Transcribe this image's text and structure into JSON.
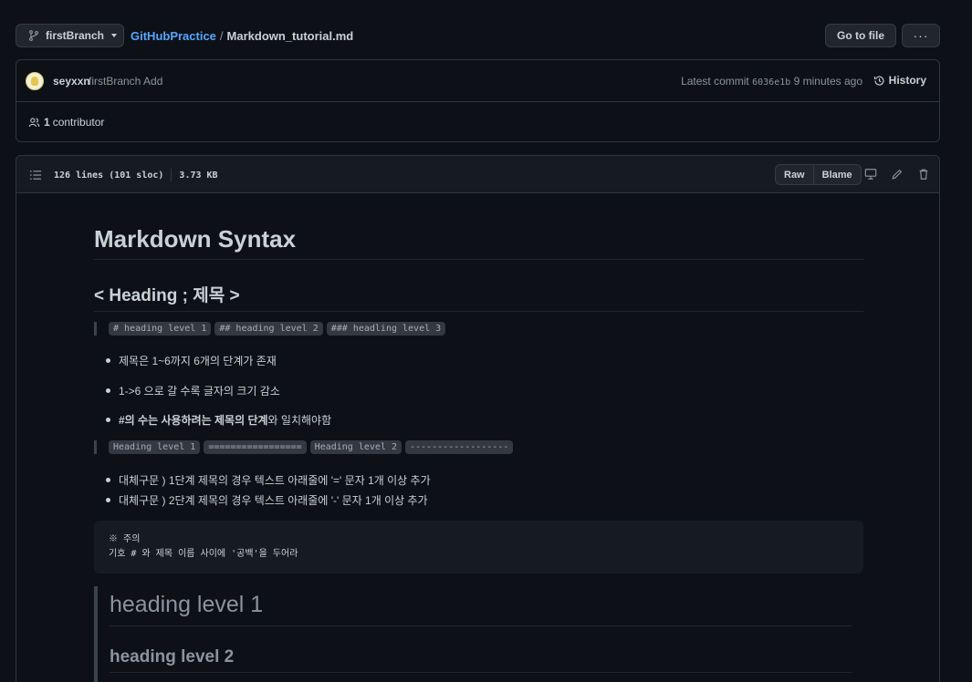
{
  "topbar": {
    "branch_label": "firstBranch",
    "repo_name": "GitHubPractice",
    "path_separator": "/",
    "file_name": "Markdown_tutorial.md",
    "goto_label": "Go to file",
    "more_label": "···"
  },
  "commit": {
    "author": "seyxxn",
    "message": "firstBranch Add",
    "latest_prefix": "Latest commit",
    "sha": "6036e1b",
    "time": "9 minutes ago",
    "history_label": "History"
  },
  "contributors": {
    "count": "1",
    "label": "contributor"
  },
  "file": {
    "lines": "126 lines (101 sloc)",
    "size": "3.73 KB",
    "raw_label": "Raw",
    "blame_label": "Blame"
  },
  "markdown": {
    "title": "Markdown Syntax",
    "section_heading": "< Heading ; 제목 >",
    "quote1_codes": [
      "# heading level 1",
      "## heading level 2",
      "### headling level 3"
    ],
    "bullets1": [
      {
        "text": "제목은 1~6까지 6개의 단계가 존재"
      },
      {
        "text": "1->6 으로 갈 수록 글자의 크기 감소"
      },
      {
        "bold": "#의 수는 사용하려는 제목의 단계",
        "rest": "와 일치해야함"
      }
    ],
    "quote2_codes": [
      "Heading level 1",
      "=================",
      "Heading level 2",
      "------------------"
    ],
    "bullets2": [
      "대체구문 ) 1단계 제목의 경우 텍스트 아래줄에 '=' 문자 1개 이상 추가",
      "대체구문 ) 2단계 제목의 경우 텍스트 아래줄에 '-' 문자 1개 이상 추가"
    ],
    "code_block": {
      "line1": "※ 주의",
      "line2": "기호 # 와 제목 이름 사이에 '공백'을 두어라"
    },
    "quote_h1": "heading level 1",
    "quote_h2": "heading level 2"
  },
  "colors": {
    "background": "#0d1117",
    "link": "#58a6ff",
    "muted": "#8b949e",
    "border": "#30363d"
  }
}
